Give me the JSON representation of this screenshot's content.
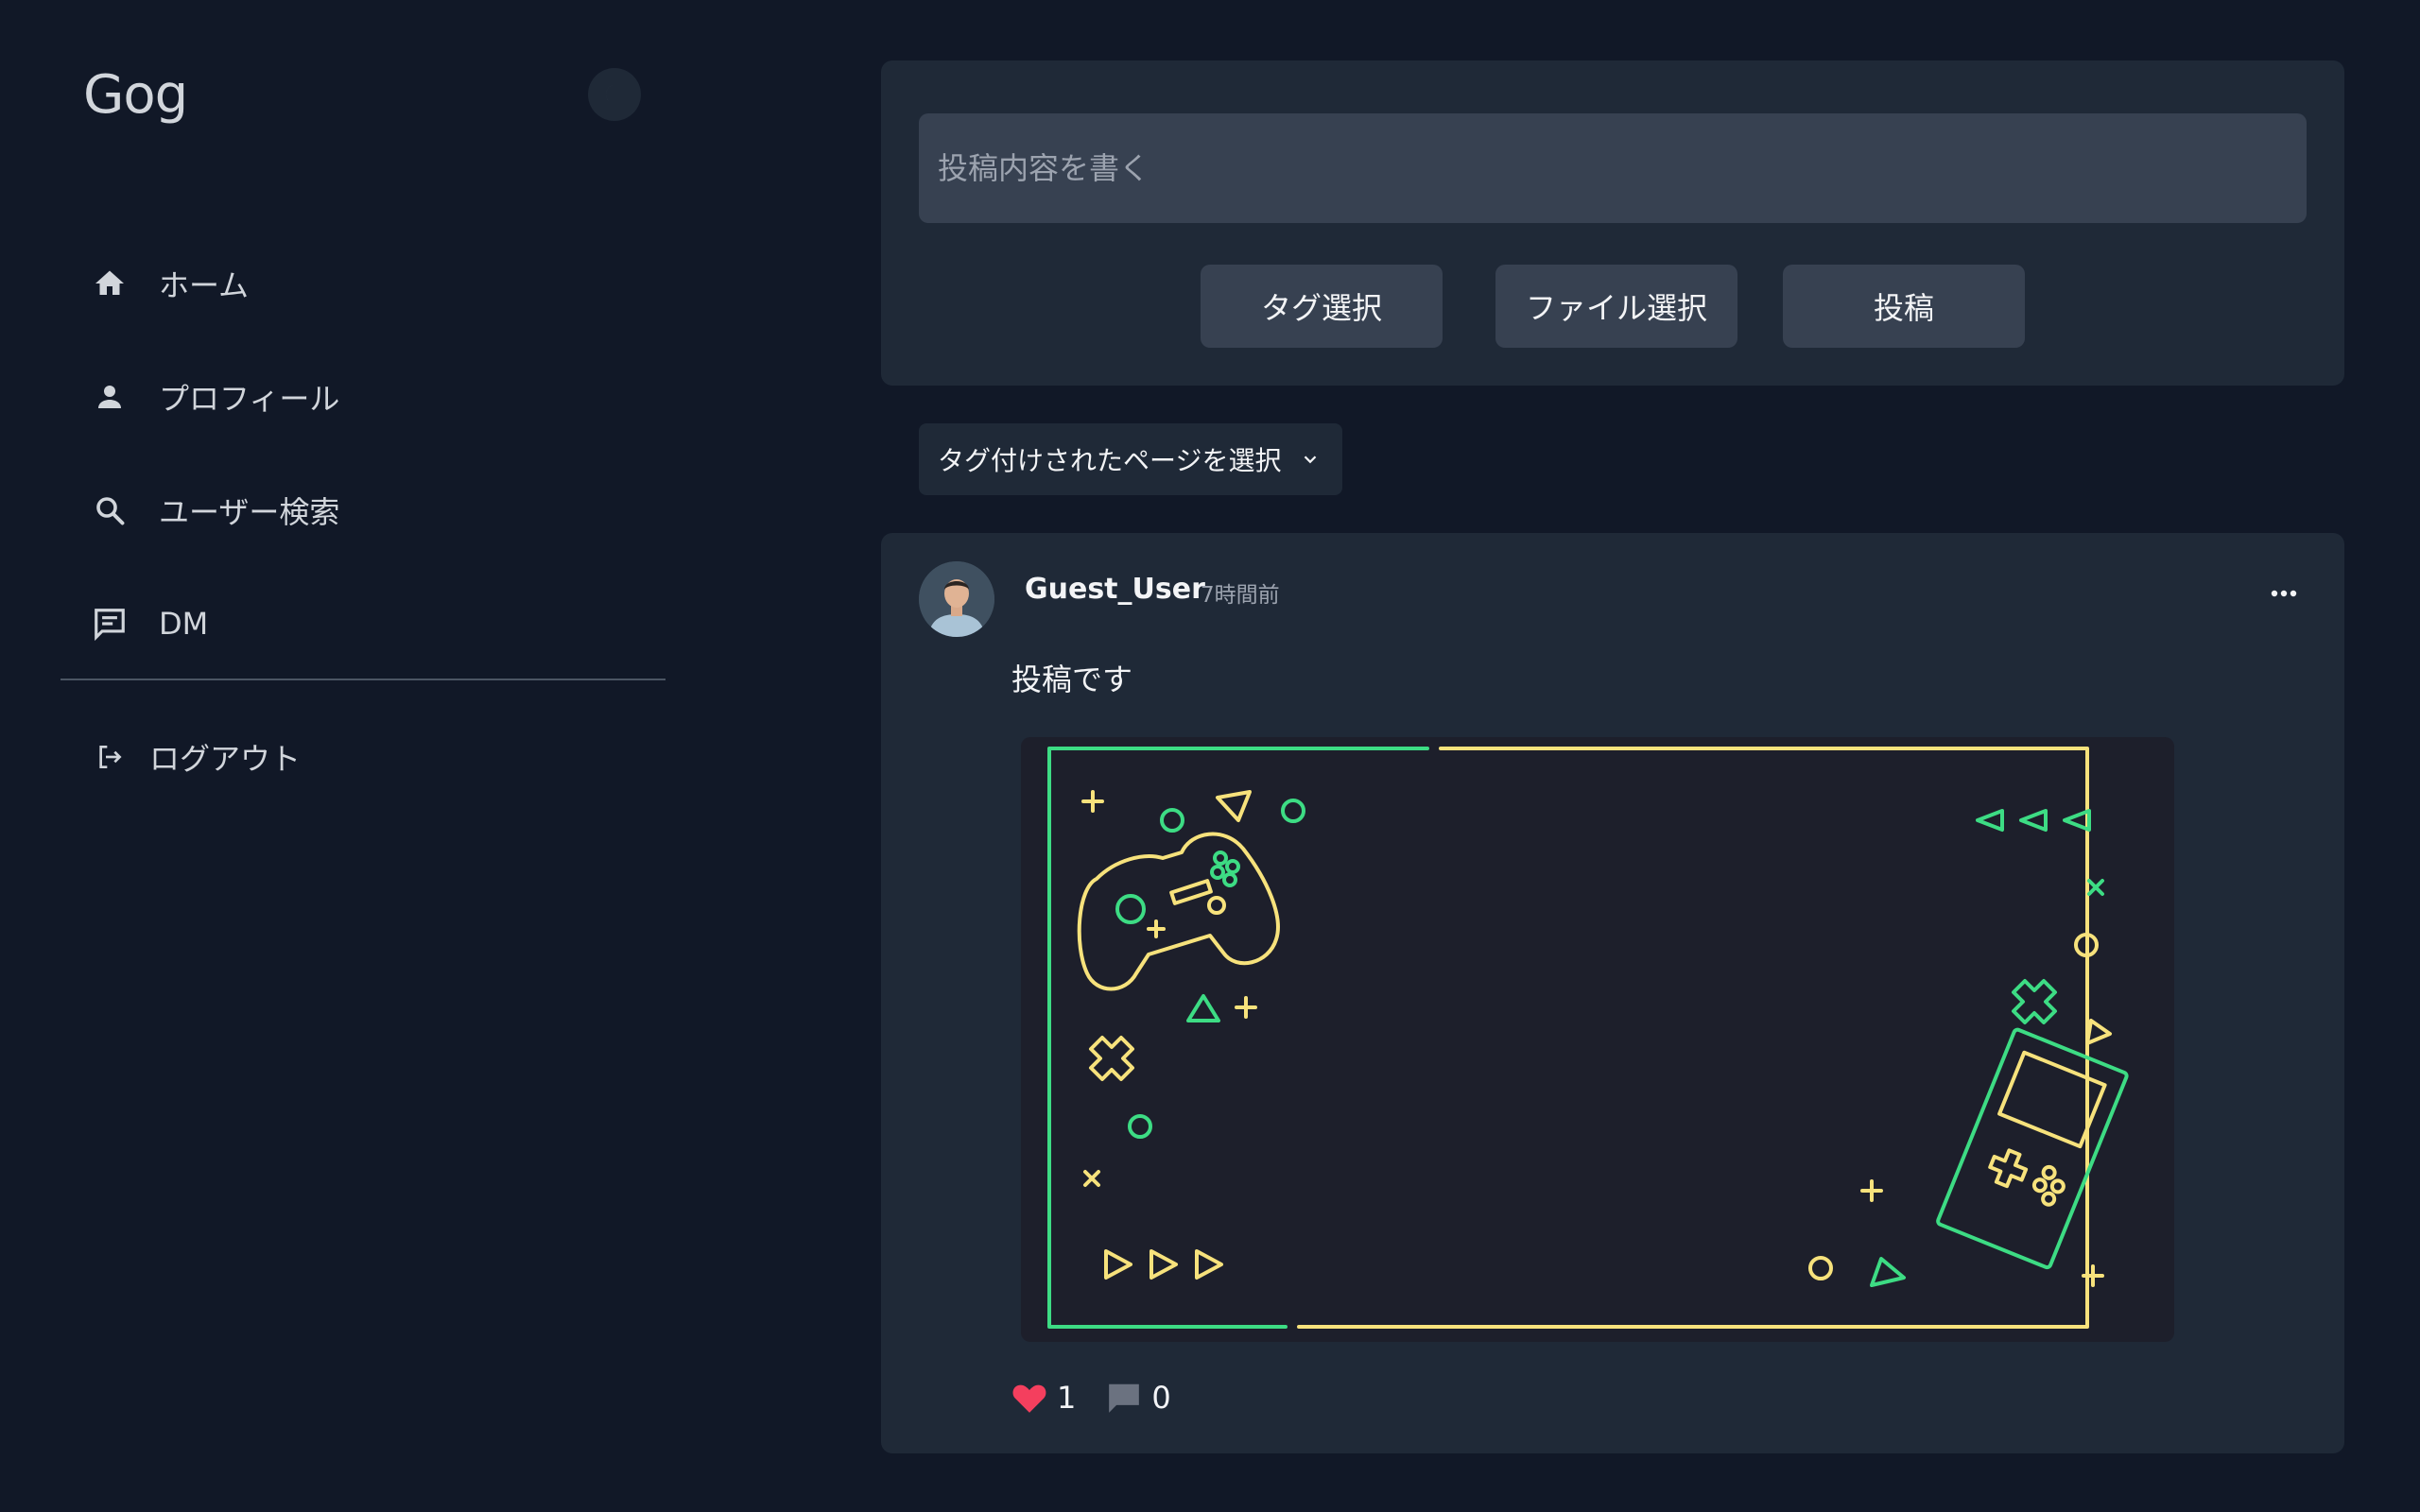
{
  "app": {
    "title": "Gog"
  },
  "nav": {
    "home": "ホーム",
    "profile": "プロフィール",
    "user_search": "ユーザー検索",
    "dm": "DM",
    "logout": "ログアウト"
  },
  "composer": {
    "placeholder": "投稿内容を書く",
    "tag_button": "タグ選択",
    "file_button": "ファイル選択",
    "post_button": "投稿"
  },
  "filter": {
    "tag_page_select": "タグ付けされたページを選択"
  },
  "post": {
    "username": "Guest_User",
    "timestamp": "7時間前",
    "text": "投稿です",
    "likes": "1",
    "comments": "0"
  },
  "colors": {
    "background": "#111827",
    "panel": "#1f2937",
    "input": "#374151",
    "like": "#f43f5e",
    "neon_green": "#3ddc84",
    "neon_yellow": "#f7e27c"
  }
}
